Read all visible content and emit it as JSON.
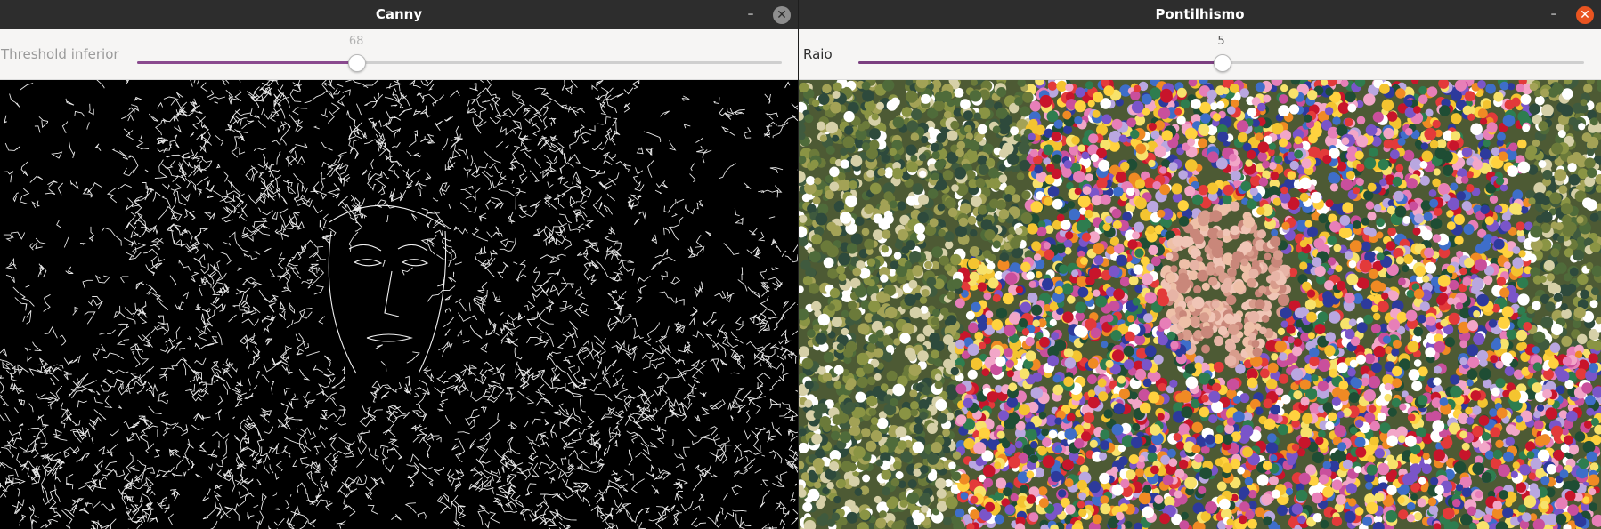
{
  "windows": [
    {
      "title": "Canny",
      "trackbar": {
        "label": "Threshold inferior",
        "value": "68",
        "fraction": 0.34
      },
      "image": "edge-detection-image"
    },
    {
      "title": "Pontilhismo",
      "trackbar": {
        "label": "Raio",
        "value": "5",
        "fraction": 0.5
      },
      "image": "pointillism-image"
    }
  ],
  "icons": {
    "minimize": "minimize-icon",
    "close": "close-icon"
  },
  "colors": {
    "titlebar": "#2d2d2d",
    "trackbar_fill": "#8a4a8f",
    "close_active": "#e95420",
    "close_inactive": "#8e8e8e"
  }
}
